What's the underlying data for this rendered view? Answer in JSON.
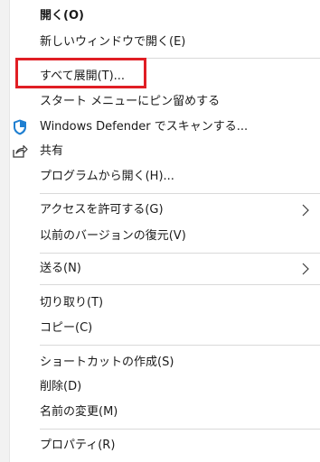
{
  "menu": {
    "open": "開く(O)",
    "open_new_window": "新しいウィンドウで開く(E)",
    "extract_all": "すべて展開(T)...",
    "pin_start": "スタート メニューにピン留めする",
    "defender_scan": "Windows Defender でスキャンする...",
    "share": "共有",
    "open_with": "プログラムから開く(H)...",
    "give_access": "アクセスを許可する(G)",
    "restore_previous": "以前のバージョンの復元(V)",
    "send_to": "送る(N)",
    "cut": "切り取り(T)",
    "copy": "コピー(C)",
    "create_shortcut": "ショートカットの作成(S)",
    "delete": "削除(D)",
    "rename": "名前の変更(M)",
    "properties": "プロパティ(R)"
  },
  "icons": {
    "defender": "shield-icon",
    "share": "share-icon",
    "submenu": "chevron-right-icon"
  },
  "colors": {
    "highlight": "#e01e24",
    "defender_shield": "#1f7fd1",
    "separator": "#d9d9d9"
  }
}
